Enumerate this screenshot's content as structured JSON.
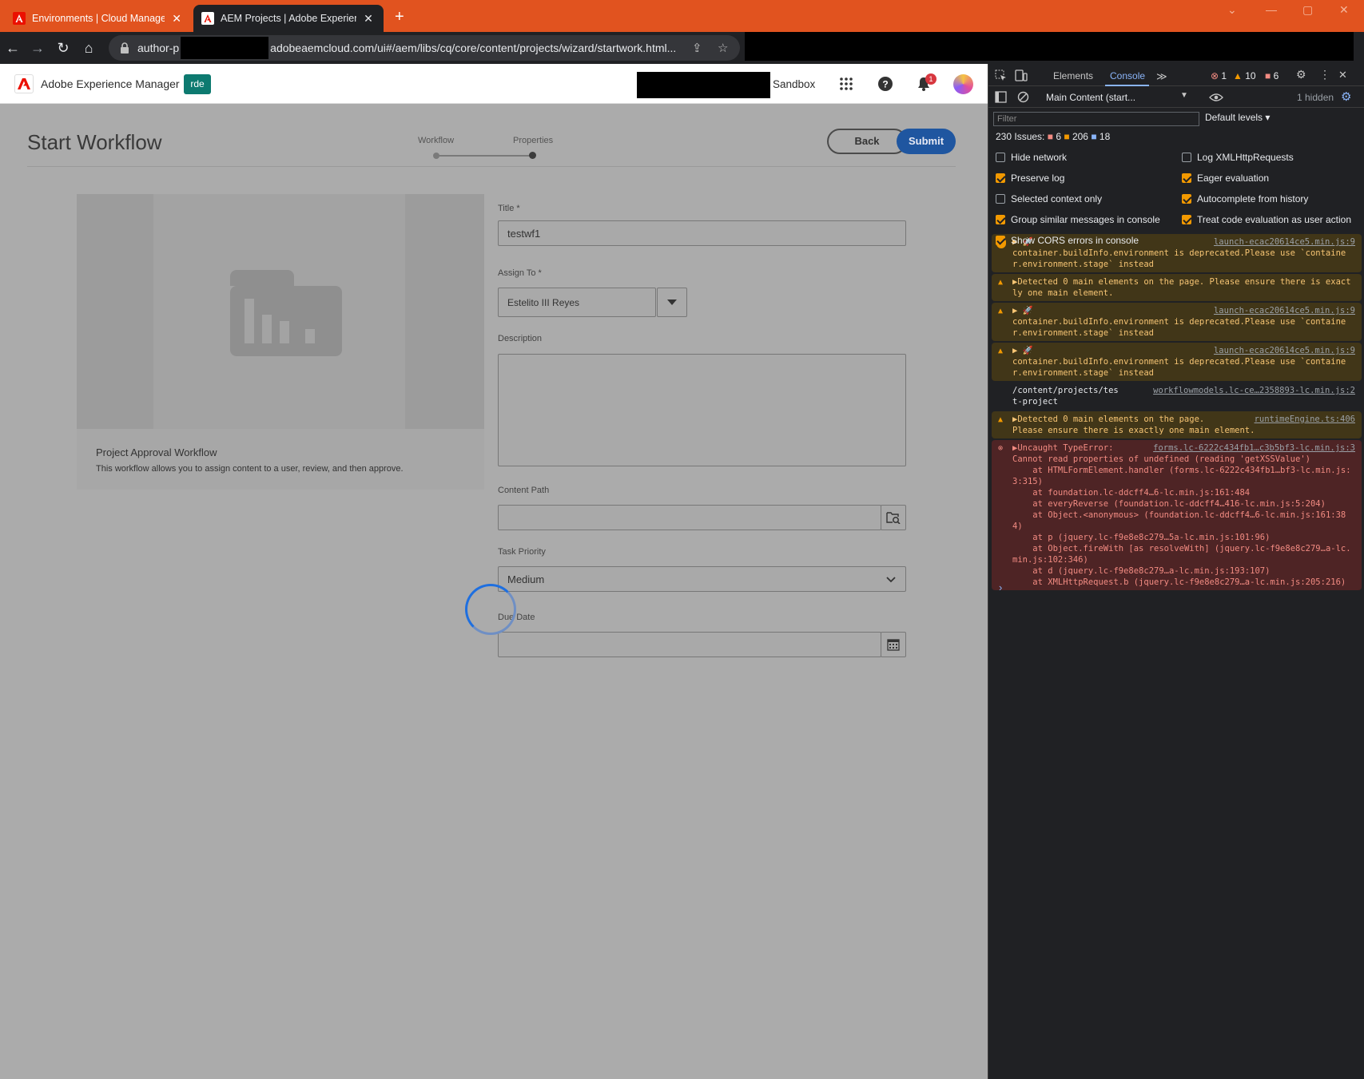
{
  "browser": {
    "tabs": [
      {
        "title": "Environments | Cloud Manager",
        "active": false
      },
      {
        "title": "AEM Projects | Adobe Experience",
        "active": true
      }
    ],
    "new_tab": "+",
    "url_prefix": "author-p",
    "url_suffix": "adobeaemcloud.com/ui#/aem/libs/cq/core/content/projects/wizard/startwork.html..."
  },
  "aem_header": {
    "product": "Adobe Experience Manager",
    "env_badge": "rde",
    "program": "Sandbox",
    "notification_count": "1"
  },
  "wizard": {
    "title": "Start Workflow",
    "steps": [
      "Workflow",
      "Properties"
    ],
    "back_label": "Back",
    "submit_label": "Submit"
  },
  "card": {
    "title": "Project Approval Workflow",
    "description": "This workflow allows you to assign content to a user, review, and then approve."
  },
  "form": {
    "title_label": "Title *",
    "title_value": "testwf1",
    "assign_label": "Assign To *",
    "assign_value": "Estelito III Reyes",
    "description_label": "Description",
    "content_path_label": "Content Path",
    "priority_label": "Task Priority",
    "priority_value": "Medium",
    "due_date_label": "Due Date"
  },
  "devtools": {
    "tabs": [
      "Elements",
      "Console"
    ],
    "error_count": "1",
    "warn_count": "10",
    "issue_count": "6",
    "context": "Main Content (start...",
    "hidden": "1 hidden",
    "filter_placeholder": "Filter",
    "levels": "Default levels ▾",
    "issues_summary": "230 Issues:",
    "issues_err": "6",
    "issues_warn": "206",
    "issues_info": "18",
    "options_left": [
      {
        "label": "Hide network",
        "checked": false
      },
      {
        "label": "Preserve log",
        "checked": true
      },
      {
        "label": "Selected context only",
        "checked": false
      },
      {
        "label": "Group similar messages in console",
        "checked": true
      },
      {
        "label": "Show CORS errors in console",
        "checked": true
      }
    ],
    "options_right": [
      {
        "label": "Log XMLHttpRequests",
        "checked": false
      },
      {
        "label": "Eager evaluation",
        "checked": true
      },
      {
        "label": "Autocomplete from history",
        "checked": true
      },
      {
        "label": "Treat code evaluation as user action",
        "checked": true
      }
    ],
    "messages": [
      {
        "level": "warn",
        "count": "6",
        "source": "launch-ecac20614ce5.min.js:9",
        "lines": [
          "▶ 🚀",
          "container.buildInfo.environment is deprecated.Please use `container.environment.stage` instead"
        ]
      },
      {
        "level": "warn",
        "source": "",
        "lines": [
          "▶Detected 0 main elements on the page. Please ensure there is exactly one main element."
        ]
      },
      {
        "level": "warn",
        "source": "launch-ecac20614ce5.min.js:9",
        "lines": [
          "▶ 🚀",
          "container.buildInfo.environment is deprecated.Please use `container.environment.stage` instead"
        ]
      },
      {
        "level": "warn",
        "source": "launch-ecac20614ce5.min.js:9",
        "lines": [
          "▶ 🚀",
          "container.buildInfo.environment is deprecated.Please use `container.environment.stage` instead"
        ]
      },
      {
        "level": "log",
        "source": "workflowmodels.lc-ce…2358893-lc.min.js:2",
        "lines": [
          "/content/projects/tes",
          "t-project"
        ]
      },
      {
        "level": "warn",
        "source": "runtimeEngine.ts:406",
        "lines": [
          "▶Detected 0 main elements on the page.",
          "Please ensure there is exactly one main element."
        ]
      },
      {
        "level": "err",
        "source": "forms.lc-6222c434fb1…c3b5bf3-lc.min.js:3",
        "lines": [
          "▶Uncaught TypeError:",
          "Cannot read properties of undefined (reading 'getXSSValue')",
          "    at HTMLFormElement.handler (forms.lc-6222c434fb1…bf3-lc.min.js:3:315)",
          "    at foundation.lc-ddcff4…6-lc.min.js:161:484",
          "    at everyReverse (foundation.lc-ddcff4…416-lc.min.js:5:204)",
          "    at Object.<anonymous> (foundation.lc-ddcff4…6-lc.min.js:161:384)",
          "    at p (jquery.lc-f9e8e8c279…5a-lc.min.js:101:96)",
          "    at Object.fireWith [as resolveWith] (jquery.lc-f9e8e8c279…a-lc.min.js:102:346)",
          "    at d (jquery.lc-f9e8e8c279…a-lc.min.js:193:107)",
          "    at XMLHttpRequest.b (jquery.lc-f9e8e8c279…a-lc.min.js:205:216)"
        ]
      }
    ],
    "prompt": "›"
  }
}
